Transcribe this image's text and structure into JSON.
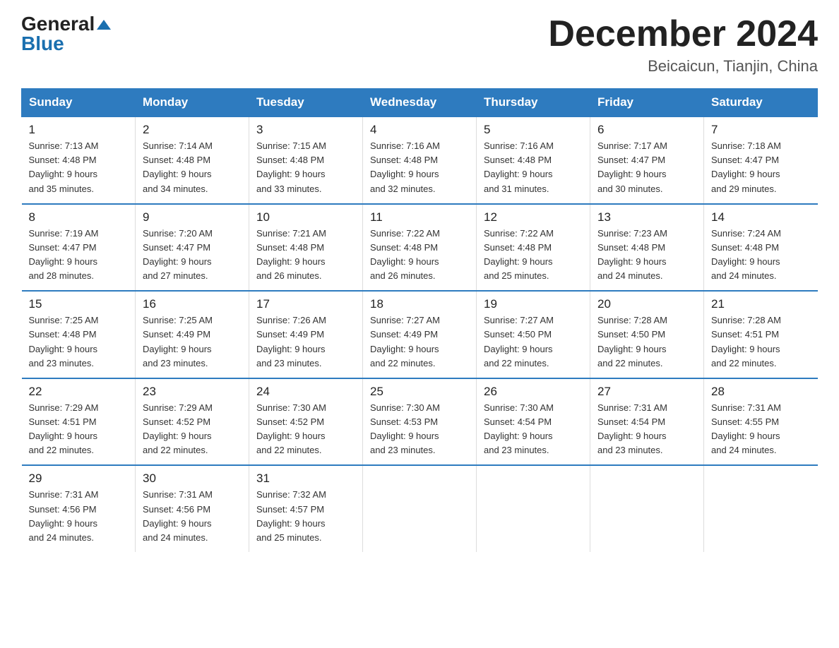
{
  "logo": {
    "general": "General",
    "blue": "Blue"
  },
  "title": {
    "month_year": "December 2024",
    "location": "Beicaicun, Tianjin, China"
  },
  "weekdays": [
    "Sunday",
    "Monday",
    "Tuesday",
    "Wednesday",
    "Thursday",
    "Friday",
    "Saturday"
  ],
  "weeks": [
    [
      {
        "day": "1",
        "sunrise": "7:13 AM",
        "sunset": "4:48 PM",
        "daylight": "9 hours and 35 minutes."
      },
      {
        "day": "2",
        "sunrise": "7:14 AM",
        "sunset": "4:48 PM",
        "daylight": "9 hours and 34 minutes."
      },
      {
        "day": "3",
        "sunrise": "7:15 AM",
        "sunset": "4:48 PM",
        "daylight": "9 hours and 33 minutes."
      },
      {
        "day": "4",
        "sunrise": "7:16 AM",
        "sunset": "4:48 PM",
        "daylight": "9 hours and 32 minutes."
      },
      {
        "day": "5",
        "sunrise": "7:16 AM",
        "sunset": "4:48 PM",
        "daylight": "9 hours and 31 minutes."
      },
      {
        "day": "6",
        "sunrise": "7:17 AM",
        "sunset": "4:47 PM",
        "daylight": "9 hours and 30 minutes."
      },
      {
        "day": "7",
        "sunrise": "7:18 AM",
        "sunset": "4:47 PM",
        "daylight": "9 hours and 29 minutes."
      }
    ],
    [
      {
        "day": "8",
        "sunrise": "7:19 AM",
        "sunset": "4:47 PM",
        "daylight": "9 hours and 28 minutes."
      },
      {
        "day": "9",
        "sunrise": "7:20 AM",
        "sunset": "4:47 PM",
        "daylight": "9 hours and 27 minutes."
      },
      {
        "day": "10",
        "sunrise": "7:21 AM",
        "sunset": "4:48 PM",
        "daylight": "9 hours and 26 minutes."
      },
      {
        "day": "11",
        "sunrise": "7:22 AM",
        "sunset": "4:48 PM",
        "daylight": "9 hours and 26 minutes."
      },
      {
        "day": "12",
        "sunrise": "7:22 AM",
        "sunset": "4:48 PM",
        "daylight": "9 hours and 25 minutes."
      },
      {
        "day": "13",
        "sunrise": "7:23 AM",
        "sunset": "4:48 PM",
        "daylight": "9 hours and 24 minutes."
      },
      {
        "day": "14",
        "sunrise": "7:24 AM",
        "sunset": "4:48 PM",
        "daylight": "9 hours and 24 minutes."
      }
    ],
    [
      {
        "day": "15",
        "sunrise": "7:25 AM",
        "sunset": "4:48 PM",
        "daylight": "9 hours and 23 minutes."
      },
      {
        "day": "16",
        "sunrise": "7:25 AM",
        "sunset": "4:49 PM",
        "daylight": "9 hours and 23 minutes."
      },
      {
        "day": "17",
        "sunrise": "7:26 AM",
        "sunset": "4:49 PM",
        "daylight": "9 hours and 23 minutes."
      },
      {
        "day": "18",
        "sunrise": "7:27 AM",
        "sunset": "4:49 PM",
        "daylight": "9 hours and 22 minutes."
      },
      {
        "day": "19",
        "sunrise": "7:27 AM",
        "sunset": "4:50 PM",
        "daylight": "9 hours and 22 minutes."
      },
      {
        "day": "20",
        "sunrise": "7:28 AM",
        "sunset": "4:50 PM",
        "daylight": "9 hours and 22 minutes."
      },
      {
        "day": "21",
        "sunrise": "7:28 AM",
        "sunset": "4:51 PM",
        "daylight": "9 hours and 22 minutes."
      }
    ],
    [
      {
        "day": "22",
        "sunrise": "7:29 AM",
        "sunset": "4:51 PM",
        "daylight": "9 hours and 22 minutes."
      },
      {
        "day": "23",
        "sunrise": "7:29 AM",
        "sunset": "4:52 PM",
        "daylight": "9 hours and 22 minutes."
      },
      {
        "day": "24",
        "sunrise": "7:30 AM",
        "sunset": "4:52 PM",
        "daylight": "9 hours and 22 minutes."
      },
      {
        "day": "25",
        "sunrise": "7:30 AM",
        "sunset": "4:53 PM",
        "daylight": "9 hours and 23 minutes."
      },
      {
        "day": "26",
        "sunrise": "7:30 AM",
        "sunset": "4:54 PM",
        "daylight": "9 hours and 23 minutes."
      },
      {
        "day": "27",
        "sunrise": "7:31 AM",
        "sunset": "4:54 PM",
        "daylight": "9 hours and 23 minutes."
      },
      {
        "day": "28",
        "sunrise": "7:31 AM",
        "sunset": "4:55 PM",
        "daylight": "9 hours and 24 minutes."
      }
    ],
    [
      {
        "day": "29",
        "sunrise": "7:31 AM",
        "sunset": "4:56 PM",
        "daylight": "9 hours and 24 minutes."
      },
      {
        "day": "30",
        "sunrise": "7:31 AM",
        "sunset": "4:56 PM",
        "daylight": "9 hours and 24 minutes."
      },
      {
        "day": "31",
        "sunrise": "7:32 AM",
        "sunset": "4:57 PM",
        "daylight": "9 hours and 25 minutes."
      },
      null,
      null,
      null,
      null
    ]
  ],
  "labels": {
    "sunrise": "Sunrise:",
    "sunset": "Sunset:",
    "daylight": "Daylight:"
  }
}
